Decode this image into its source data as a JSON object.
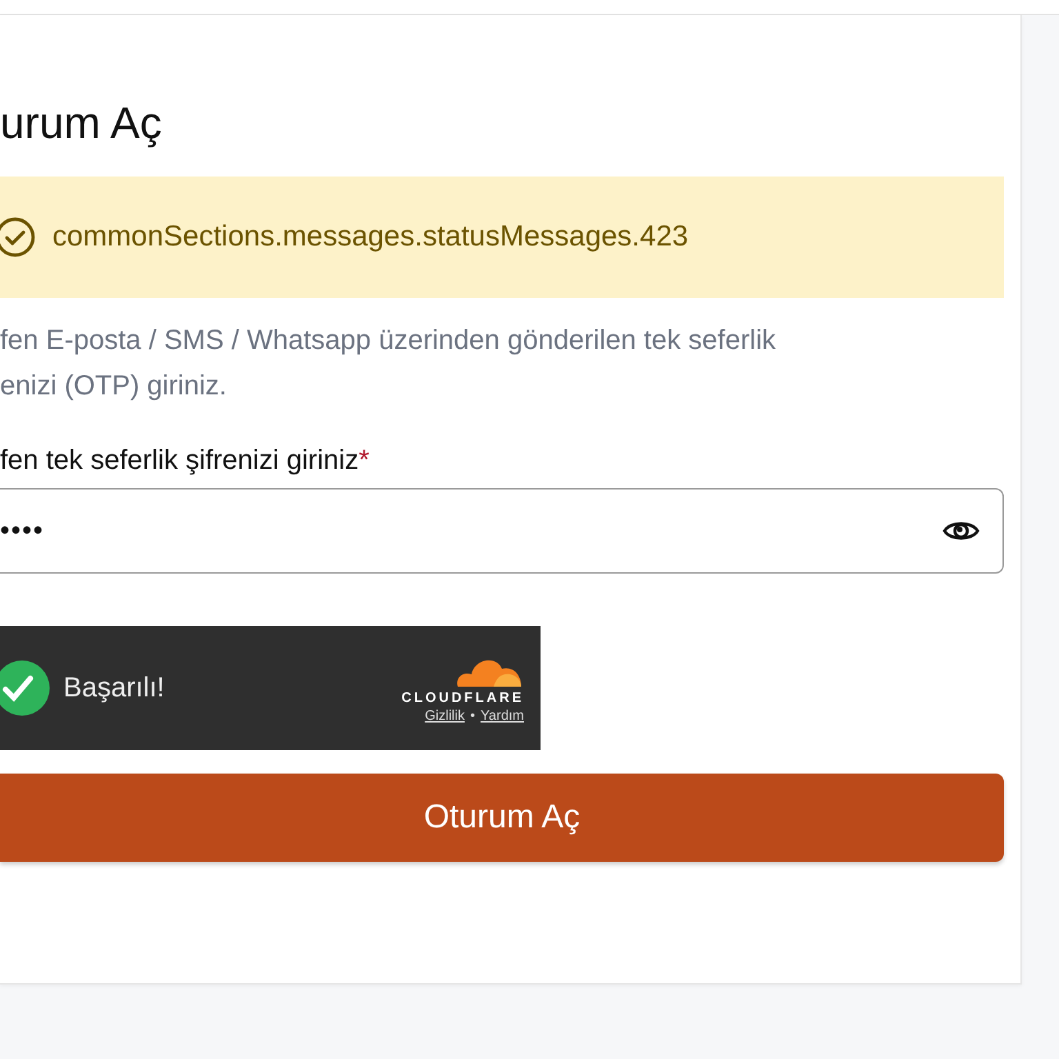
{
  "title": "urum Aç",
  "alert": {
    "message": "commonSections.messages.statusMessages.423"
  },
  "description": "fen E-posta / SMS / Whatsapp üzerinden gönderilen tek seferlik\nenizi (OTP) giriniz.",
  "otp_field": {
    "label": "fen tek seferlik şifrenizi giriniz",
    "required_mark": "*",
    "value": "••••"
  },
  "captcha": {
    "status": "Başarılı!",
    "brand": "CLOUDFLARE",
    "links": [
      "Gizlilik",
      "Yardım"
    ],
    "separator": "•"
  },
  "submit_button": "Oturum Aç"
}
